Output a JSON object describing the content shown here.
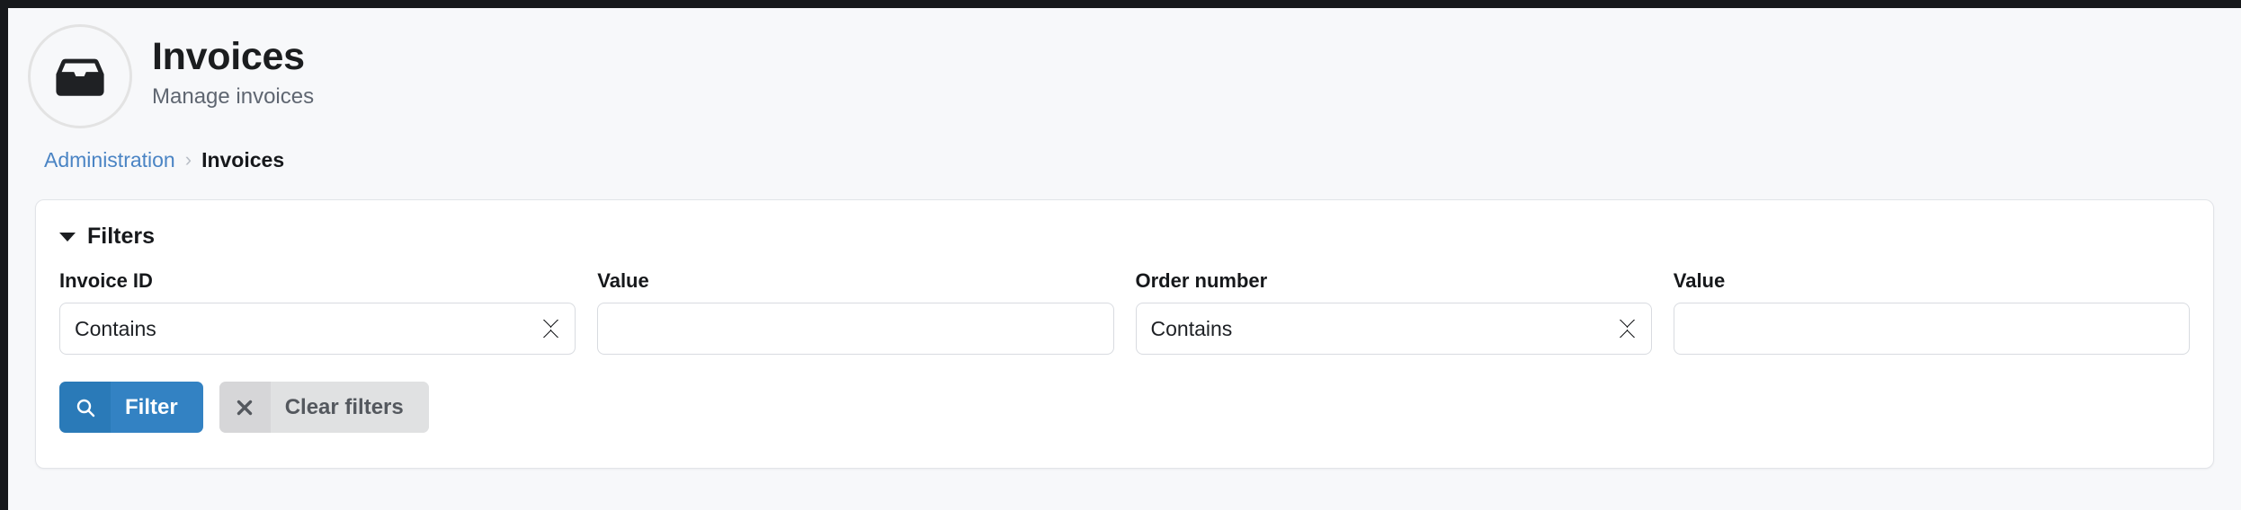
{
  "header": {
    "icon": "inbox-icon",
    "title": "Invoices",
    "subtitle": "Manage invoices"
  },
  "breadcrumb": {
    "parent": "Administration",
    "separator": "›",
    "current": "Invoices"
  },
  "filters": {
    "section_title": "Filters",
    "caret_icon": "chevron-down-icon",
    "expanded": true,
    "fields": [
      {
        "label": "Invoice ID",
        "type": "select",
        "value": "Contains",
        "options": [
          "Contains"
        ]
      },
      {
        "label": "Value",
        "type": "text",
        "value": "",
        "placeholder": ""
      },
      {
        "label": "Order number",
        "type": "select",
        "value": "Contains",
        "options": [
          "Contains"
        ]
      },
      {
        "label": "Value",
        "type": "text",
        "value": "",
        "placeholder": ""
      }
    ],
    "actions": {
      "filter": {
        "label": "Filter",
        "icon": "search-icon"
      },
      "clear": {
        "label": "Clear filters",
        "icon": "close-x-icon"
      }
    }
  },
  "colors": {
    "page_background": "#f7f8fa",
    "card_background": "#ffffff",
    "card_border": "#e2e4e8",
    "primary_button": "#3382c3",
    "primary_button_icon": "#2a7ab8",
    "secondary_button": "#e0e1e2",
    "secondary_button_icon": "#d6d6d8",
    "link": "#4a84c4",
    "text": "#16181b",
    "muted_text": "#5f6671"
  }
}
